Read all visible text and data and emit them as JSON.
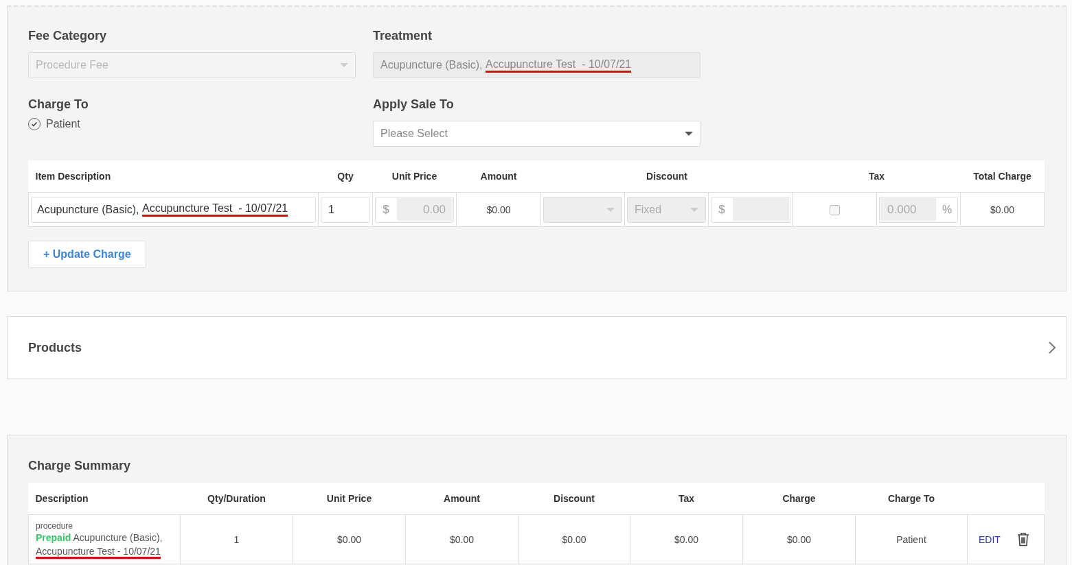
{
  "fee_form": {
    "fee_category": {
      "label": "Fee Category",
      "value": "Procedure Fee",
      "disabled": true
    },
    "treatment": {
      "label": "Treatment",
      "value": [
        {
          "text": "Acupuncture (Basic), ",
          "marked": false
        },
        {
          "text": "Accupuncture Test  - 10/07/21",
          "marked": true
        }
      ]
    },
    "charge_to": {
      "label": "Charge To",
      "options": [
        {
          "label": "Patient",
          "checked": true
        }
      ]
    },
    "apply_sale_to": {
      "label": "Apply Sale To",
      "placeholder": "Please Select"
    },
    "item_table": {
      "columns": [
        "Item Description",
        "Qty",
        "Unit Price",
        "Amount",
        "Discount",
        "Tax",
        "Total Charge"
      ],
      "rows": [
        {
          "description": [
            {
              "text": "Acupuncture (Basic), ",
              "marked": false
            },
            {
              "text": "Accupuncture Test  - 10/07/21",
              "marked": true
            }
          ],
          "qty": "1",
          "currency": "$",
          "unit_price": "0.00",
          "amount": "$0.00",
          "discount_type": "Fixed",
          "discount_currency": "$",
          "taxable": false,
          "tax_rate": "0.000",
          "tax_unit": "%",
          "total_charge": "$0.00"
        }
      ]
    },
    "update_button": {
      "icon": "+",
      "label": "Update Charge"
    }
  },
  "products": {
    "title": "Products"
  },
  "charge_summary": {
    "title": "Charge Summary",
    "columns": [
      "Description",
      "Qty/Duration",
      "Unit Price",
      "Amount",
      "Discount",
      "Tax",
      "Charge",
      "Charge To"
    ],
    "rows": [
      {
        "category": "procedure",
        "badge": "Prepaid",
        "description": [
          {
            "text": "Acupuncture (Basic),",
            "marked": false
          },
          {
            "text": "Accupuncture Test - 10/07/21",
            "marked": true
          }
        ],
        "qty": "1",
        "unit_price": "$0.00",
        "amount": "$0.00",
        "discount": "$0.00",
        "tax": "$0.00",
        "charge": "$0.00",
        "charge_to": "Patient",
        "edit": "EDIT"
      }
    ]
  }
}
